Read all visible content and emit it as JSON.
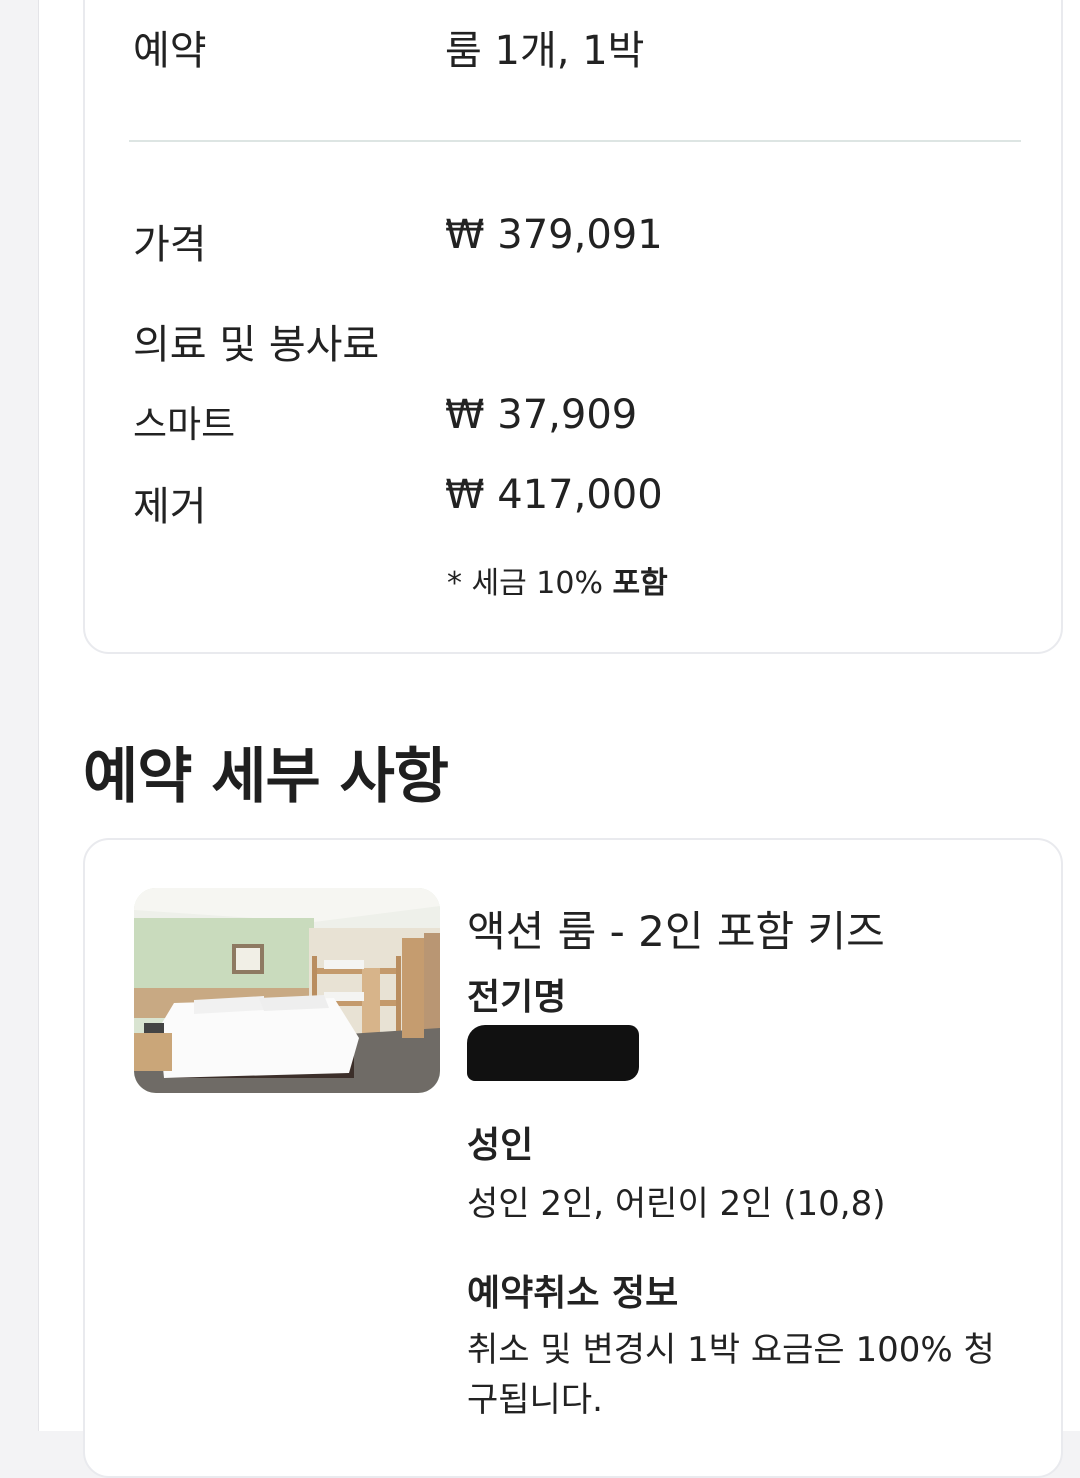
{
  "summary": {
    "reservation_label": "예약",
    "reservation_value": "룸 1개, 1박",
    "price_label": "가격",
    "price_value": "₩ 379,091",
    "fees_label": "의료 및 봉사료",
    "smart_label": "스마트",
    "smart_value": "₩ 37,909",
    "remove_label": "제거",
    "remove_value": "₩ 417,000",
    "tax_note_prefix": "* 세금 10% ",
    "tax_note_bold": "포함"
  },
  "details": {
    "section_title": "예약 세부 사항",
    "room_name": "액션 룸 - 2인 포함 키즈",
    "guest_name_heading": "전기명",
    "guests_heading": "성인",
    "guests_value": "성인 2인, 어린이 2인 (10,8)",
    "cancel_heading": "예약취소 정보",
    "cancel_line1": "취소 및 변경시 1박 요금은 100% 청",
    "cancel_line2": "구됩니다."
  },
  "colors": {
    "card_border": "#e9eaee",
    "divider": "#dde5e3",
    "redaction": "#111111",
    "text": "#222222"
  }
}
